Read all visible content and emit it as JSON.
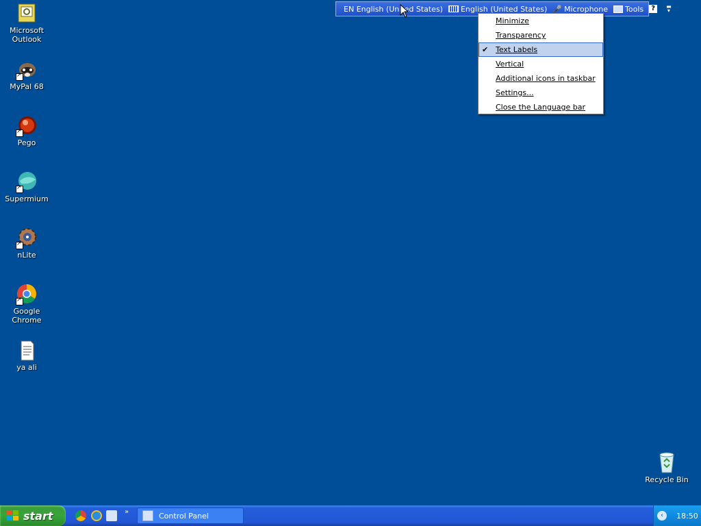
{
  "desktop": {
    "icons": [
      {
        "label": "Microsoft\nOutlook",
        "icon": "outlook-icon"
      },
      {
        "label": "MyPal 68",
        "icon": "mypal-icon"
      },
      {
        "label": "Pego",
        "icon": "pego-icon"
      },
      {
        "label": "Supermium",
        "icon": "supermium-icon"
      },
      {
        "label": "nLite",
        "icon": "nlite-icon"
      },
      {
        "label": "Google Chrome",
        "icon": "chrome-icon"
      },
      {
        "label": "ya ali",
        "icon": "text-document-icon"
      }
    ],
    "recycle_bin": {
      "label": "Recycle Bin",
      "icon": "recycle-bin-icon"
    }
  },
  "language_bar": {
    "lang_code": "EN",
    "language": "English (United States)",
    "keyboard": "English (United States)",
    "microphone": "Microphone",
    "tools": "Tools",
    "help": "?"
  },
  "context_menu": {
    "items": [
      {
        "label": "Minimize",
        "checked": false
      },
      {
        "label": "Transparency",
        "checked": false
      },
      {
        "label": "Text Labels",
        "checked": true
      },
      {
        "label": "Vertical",
        "checked": false
      },
      {
        "label": "Additional icons in taskbar",
        "checked": false
      },
      {
        "label": "Settings...",
        "checked": false
      },
      {
        "label": "Close the Language bar",
        "checked": false
      }
    ],
    "check_glyph": "✔"
  },
  "taskbar": {
    "start_label": "start",
    "quick_launch_more": "»",
    "task_label": "Control Panel",
    "clock": "18:50"
  },
  "colors": {
    "desktop": "#004e98",
    "taskbar": "#245edb",
    "start": "#37a537",
    "menu_highlight": "#c1d2ee"
  }
}
